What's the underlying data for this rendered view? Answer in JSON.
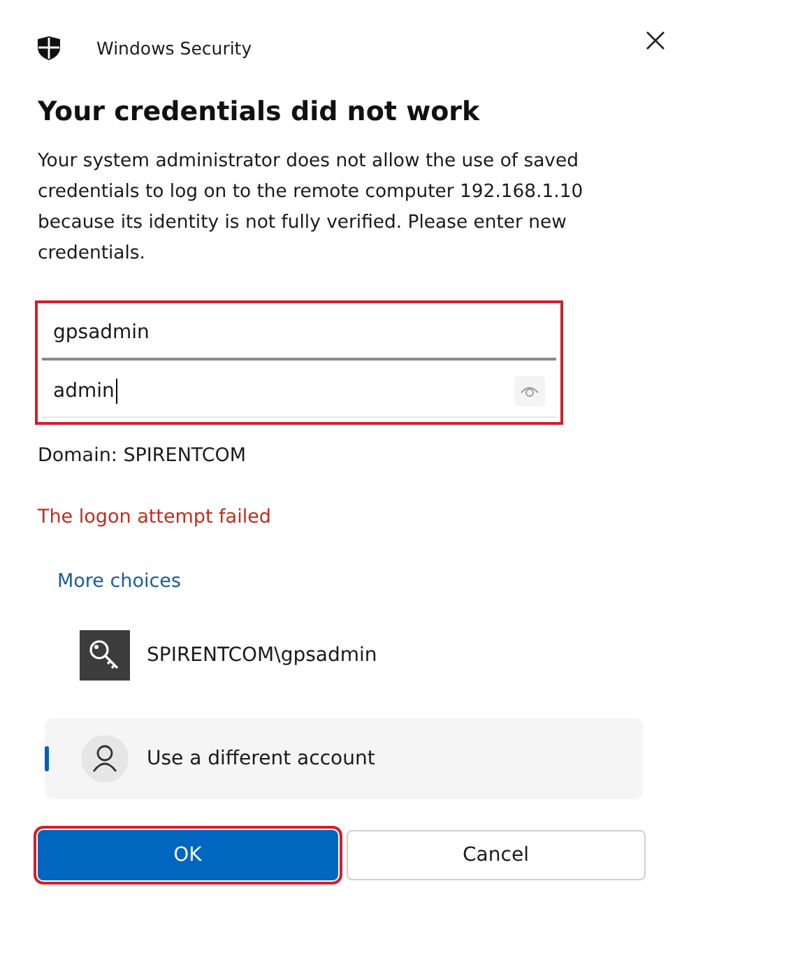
{
  "window": {
    "title": "Windows Security"
  },
  "heading": "Your credentials did not work",
  "message": "Your system administrator does not allow the use of saved credentials to log on to the remote computer 192.168.1.10 because its identity is not fully verified. Please enter new credentials.",
  "fields_highlighted": true,
  "fields": [
    {
      "kind": "text",
      "value": "gpsadmin",
      "focused": false
    },
    {
      "kind": "password",
      "value": "admin",
      "focused": true
    }
  ],
  "domain": "Domain: SPIRENTCOM",
  "error": "The logon attempt failed",
  "more_choices": "More choices",
  "accounts": [
    {
      "kind": "key",
      "label": "SPIRENTCOM\\gpsadmin",
      "selected": false
    },
    {
      "kind": "person",
      "label": "Use a different account",
      "selected": true
    }
  ],
  "buttons": [
    {
      "label": "OK",
      "primary": true,
      "highlighted": true
    },
    {
      "label": "Cancel",
      "primary": false,
      "highlighted": false
    }
  ]
}
